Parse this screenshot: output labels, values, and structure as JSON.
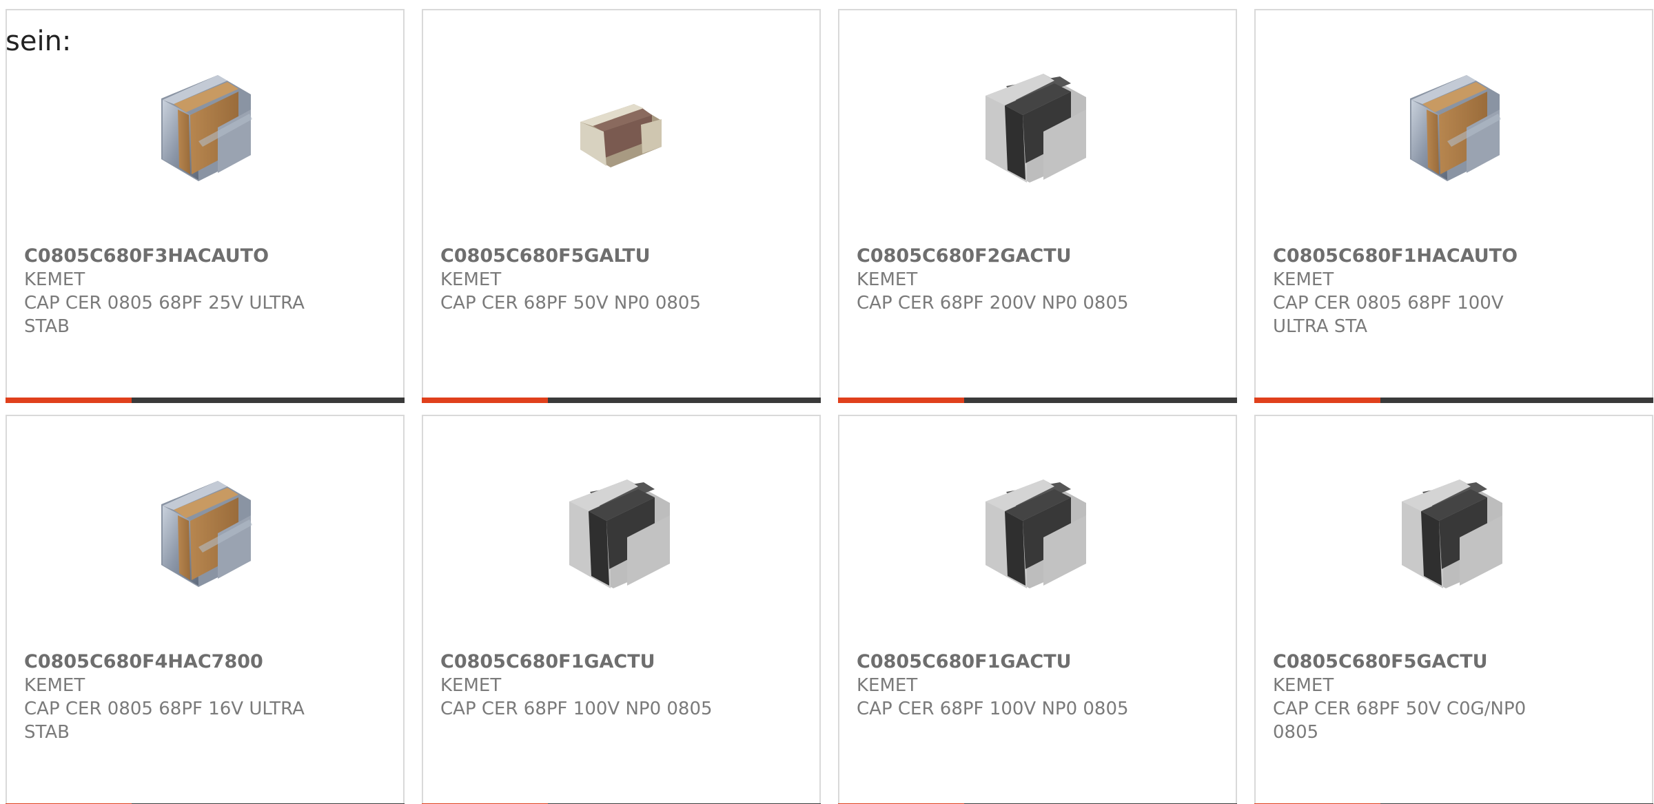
{
  "intro_text": "sein:",
  "colors": {
    "accent": "#e0401c",
    "bar": "#3a3a3a",
    "title": "#6e6e6e",
    "text": "#7a7a7a",
    "border": "#d9d9d9"
  },
  "products": [
    {
      "part_number": "C0805C680F3HACAUTO",
      "manufacturer": "KEMET",
      "description": "CAP CER 0805 68PF 25V ULTRA STAB",
      "image_icon": "capacitor-orange-chip-icon"
    },
    {
      "part_number": "C0805C680F5GALTU",
      "manufacturer": "KEMET",
      "description": "CAP CER 68PF 50V NP0 0805",
      "image_icon": "capacitor-small-brown-chip-icon"
    },
    {
      "part_number": "C0805C680F2GACTU",
      "manufacturer": "KEMET",
      "description": "CAP CER 68PF 200V NP0 0805",
      "image_icon": "capacitor-black-chip-icon"
    },
    {
      "part_number": "C0805C680F1HACAUTO",
      "manufacturer": "KEMET",
      "description": "CAP CER 0805 68PF 100V ULTRA STA",
      "image_icon": "capacitor-orange-chip-icon"
    },
    {
      "part_number": "C0805C680F4HAC7800",
      "manufacturer": "KEMET",
      "description": "CAP CER 0805 68PF 16V ULTRA STAB",
      "image_icon": "capacitor-orange-chip-icon"
    },
    {
      "part_number": "C0805C680F1GACTU",
      "manufacturer": "KEMET",
      "description": "CAP CER 68PF 100V NP0 0805",
      "image_icon": "capacitor-black-chip-icon"
    },
    {
      "part_number": "C0805C680F1GACTU",
      "manufacturer": "KEMET",
      "description": "CAP CER 68PF 100V NP0 0805",
      "image_icon": "capacitor-black-chip-icon"
    },
    {
      "part_number": "C0805C680F5GACTU",
      "manufacturer": "KEMET",
      "description": "CAP CER 68PF 50V C0G/NP0 0805",
      "image_icon": "capacitor-black-chip-icon"
    }
  ]
}
